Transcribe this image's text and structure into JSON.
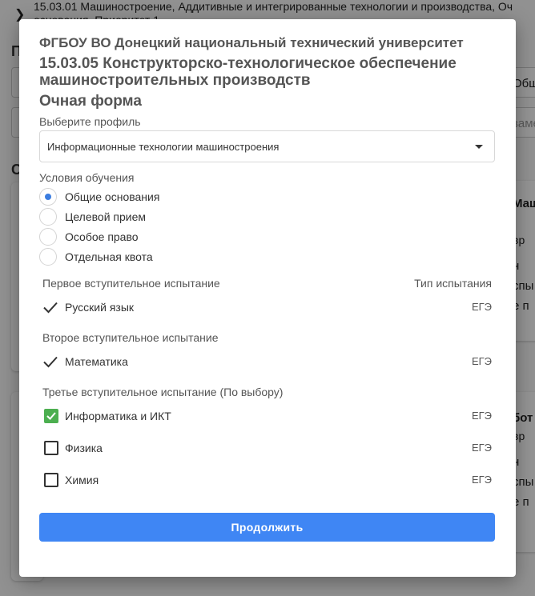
{
  "background": {
    "breadcrumb_line1": "15.03.01 Машиностроение, Аддитивные и интегрированные технологии и производства, Оч",
    "breadcrumb_line2": "основания, Приоритет 1",
    "side_letter_1": "П",
    "side_letter_2": "С",
    "right_text_1": "Общ",
    "right_text_2": "заме",
    "right_text_3": "Маши",
    "right_text_4": "вр",
    "right_text_5": "н",
    "right_text_6": "спы",
    "right_text_7": "е п",
    "right_text_8": "бот",
    "right_text_9": "вр",
    "right_text_10": "н",
    "right_text_11": "спы",
    "right_text_12": "е п"
  },
  "modal": {
    "university": "ФГБОУ ВО Донецкий национальный технический университет",
    "specialty": "15.03.05 Конструкторско-технологическое обеспечение машиностроительных производств",
    "study_form": "Очная форма",
    "profile_label": "Выберите профиль",
    "profile_value": "Информационные технологии машиностроения",
    "conditions_label": "Условия обучения",
    "conditions": [
      {
        "label": "Общие основания",
        "selected": true
      },
      {
        "label": "Целевой прием",
        "selected": false
      },
      {
        "label": "Особое право",
        "selected": false
      },
      {
        "label": "Отдельная квота",
        "selected": false
      }
    ],
    "exam_type_header": "Тип испытания",
    "exam1_title": "Первое вступительное испытание",
    "exam1_subject": "Русский язык",
    "exam1_type": "ЕГЭ",
    "exam2_title": "Второе вступительное испытание",
    "exam2_subject": "Математика",
    "exam2_type": "ЕГЭ",
    "exam3_title": "Третье вступительное испытание (По выбору)",
    "exam3_options": [
      {
        "label": "Информатика и ИКТ",
        "type": "ЕГЭ",
        "checked": true
      },
      {
        "label": "Физика",
        "type": "ЕГЭ",
        "checked": false
      },
      {
        "label": "Химия",
        "type": "ЕГЭ",
        "checked": false
      }
    ],
    "continue_label": "Продолжить"
  },
  "colors": {
    "accent": "#3f86f4",
    "radio_selected": "#3b7de0",
    "checkbox_checked": "#4caf50"
  }
}
